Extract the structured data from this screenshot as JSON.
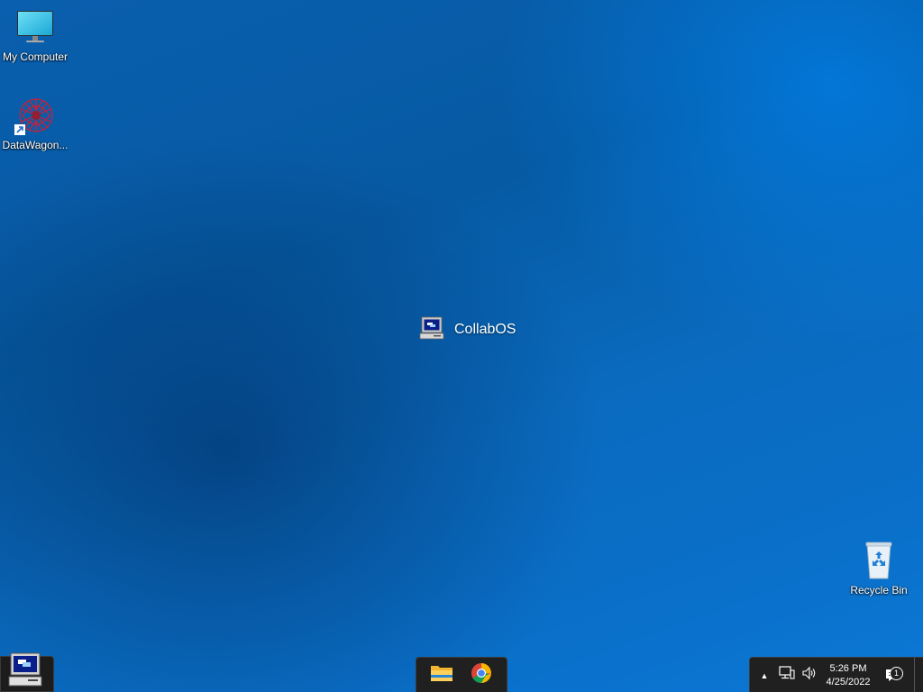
{
  "desktop": {
    "icons": [
      {
        "label": "My Computer",
        "icon": "monitor-icon"
      },
      {
        "label": "DataWagon...",
        "icon": "datawagon-icon"
      },
      {
        "label": "Recycle Bin",
        "icon": "recycle-bin-icon"
      }
    ],
    "center_brand": {
      "label": "CollabOS",
      "icon": "retro-computer-icon"
    }
  },
  "taskbar": {
    "start_icon": "retro-computer-icon",
    "pinned_apps": [
      {
        "name": "File Explorer",
        "icon": "folder-icon"
      },
      {
        "name": "Google Chrome",
        "icon": "chrome-icon"
      }
    ],
    "tray": {
      "chevron": "▲",
      "time": "5:26 PM",
      "date": "4/25/2022",
      "notification_count": "1"
    }
  },
  "colors": {
    "desktop_base": "#0a64b4",
    "taskbar_bg": "#202020"
  }
}
